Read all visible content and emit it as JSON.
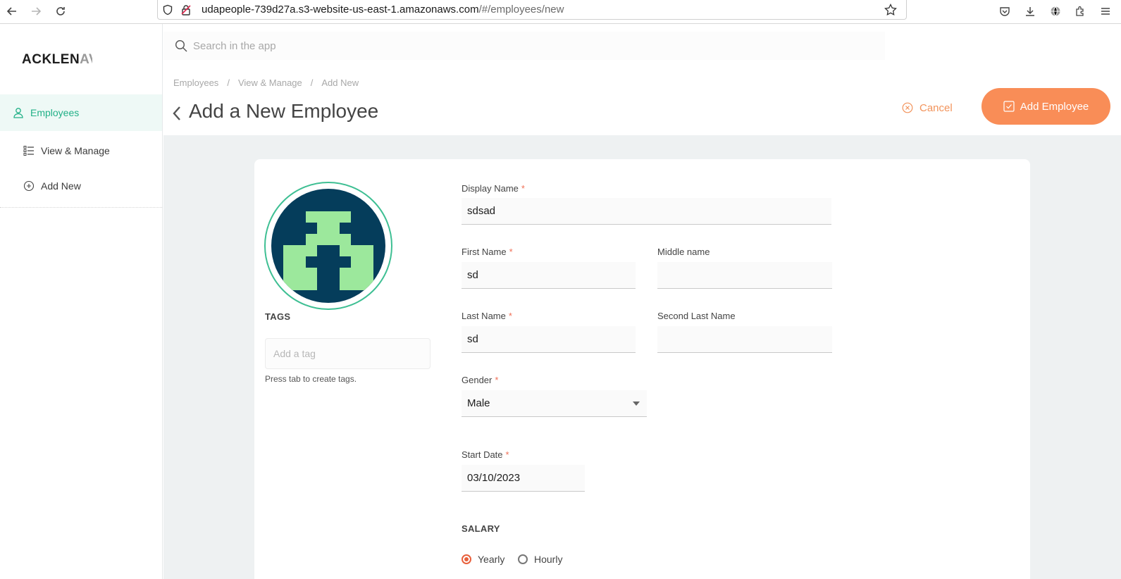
{
  "browser": {
    "url_host": "udapeople-739d27a.s3-website-us-east-1.amazonaws.com",
    "url_path": "/#/employees/new"
  },
  "sidebar": {
    "logo_main": "ACKLEN",
    "logo_fade": "AV",
    "items": [
      {
        "label": "Employees",
        "icon": "user-icon",
        "active": true
      },
      {
        "label": "View & Manage",
        "icon": "list-icon",
        "active": false
      },
      {
        "label": "Add New",
        "icon": "plus-circle-icon",
        "active": false
      }
    ]
  },
  "header": {
    "search_placeholder": "Search in the app",
    "breadcrumb": [
      "Employees",
      "View & Manage",
      "Add New"
    ],
    "title": "Add a New Employee",
    "cancel_label": "Cancel",
    "add_label": "Add Employee"
  },
  "form": {
    "tags_label": "TAGS",
    "tags_placeholder": "Add a tag",
    "tags_hint": "Press tab to create tags.",
    "display_name": {
      "label": "Display Name",
      "value": "sdsad",
      "required": "*"
    },
    "first_name": {
      "label": "First Name",
      "value": "sd",
      "required": "*"
    },
    "middle_name": {
      "label": "Middle name",
      "value": ""
    },
    "last_name": {
      "label": "Last Name",
      "value": "sd",
      "required": "*"
    },
    "second_last_name": {
      "label": "Second Last Name",
      "value": ""
    },
    "gender": {
      "label": "Gender",
      "value": "Male",
      "required": "*"
    },
    "start_date": {
      "label": "Start Date",
      "value": "03/10/2023",
      "required": "*"
    },
    "salary": {
      "label": "SALARY",
      "options": [
        {
          "label": "Yearly",
          "checked": true
        },
        {
          "label": "Hourly",
          "checked": false
        }
      ]
    }
  },
  "colors": {
    "accent_green": "#21b087",
    "accent_orange": "#f98d57",
    "avatar_bg": "#053d5b",
    "avatar_fg": "#9ce89c"
  }
}
